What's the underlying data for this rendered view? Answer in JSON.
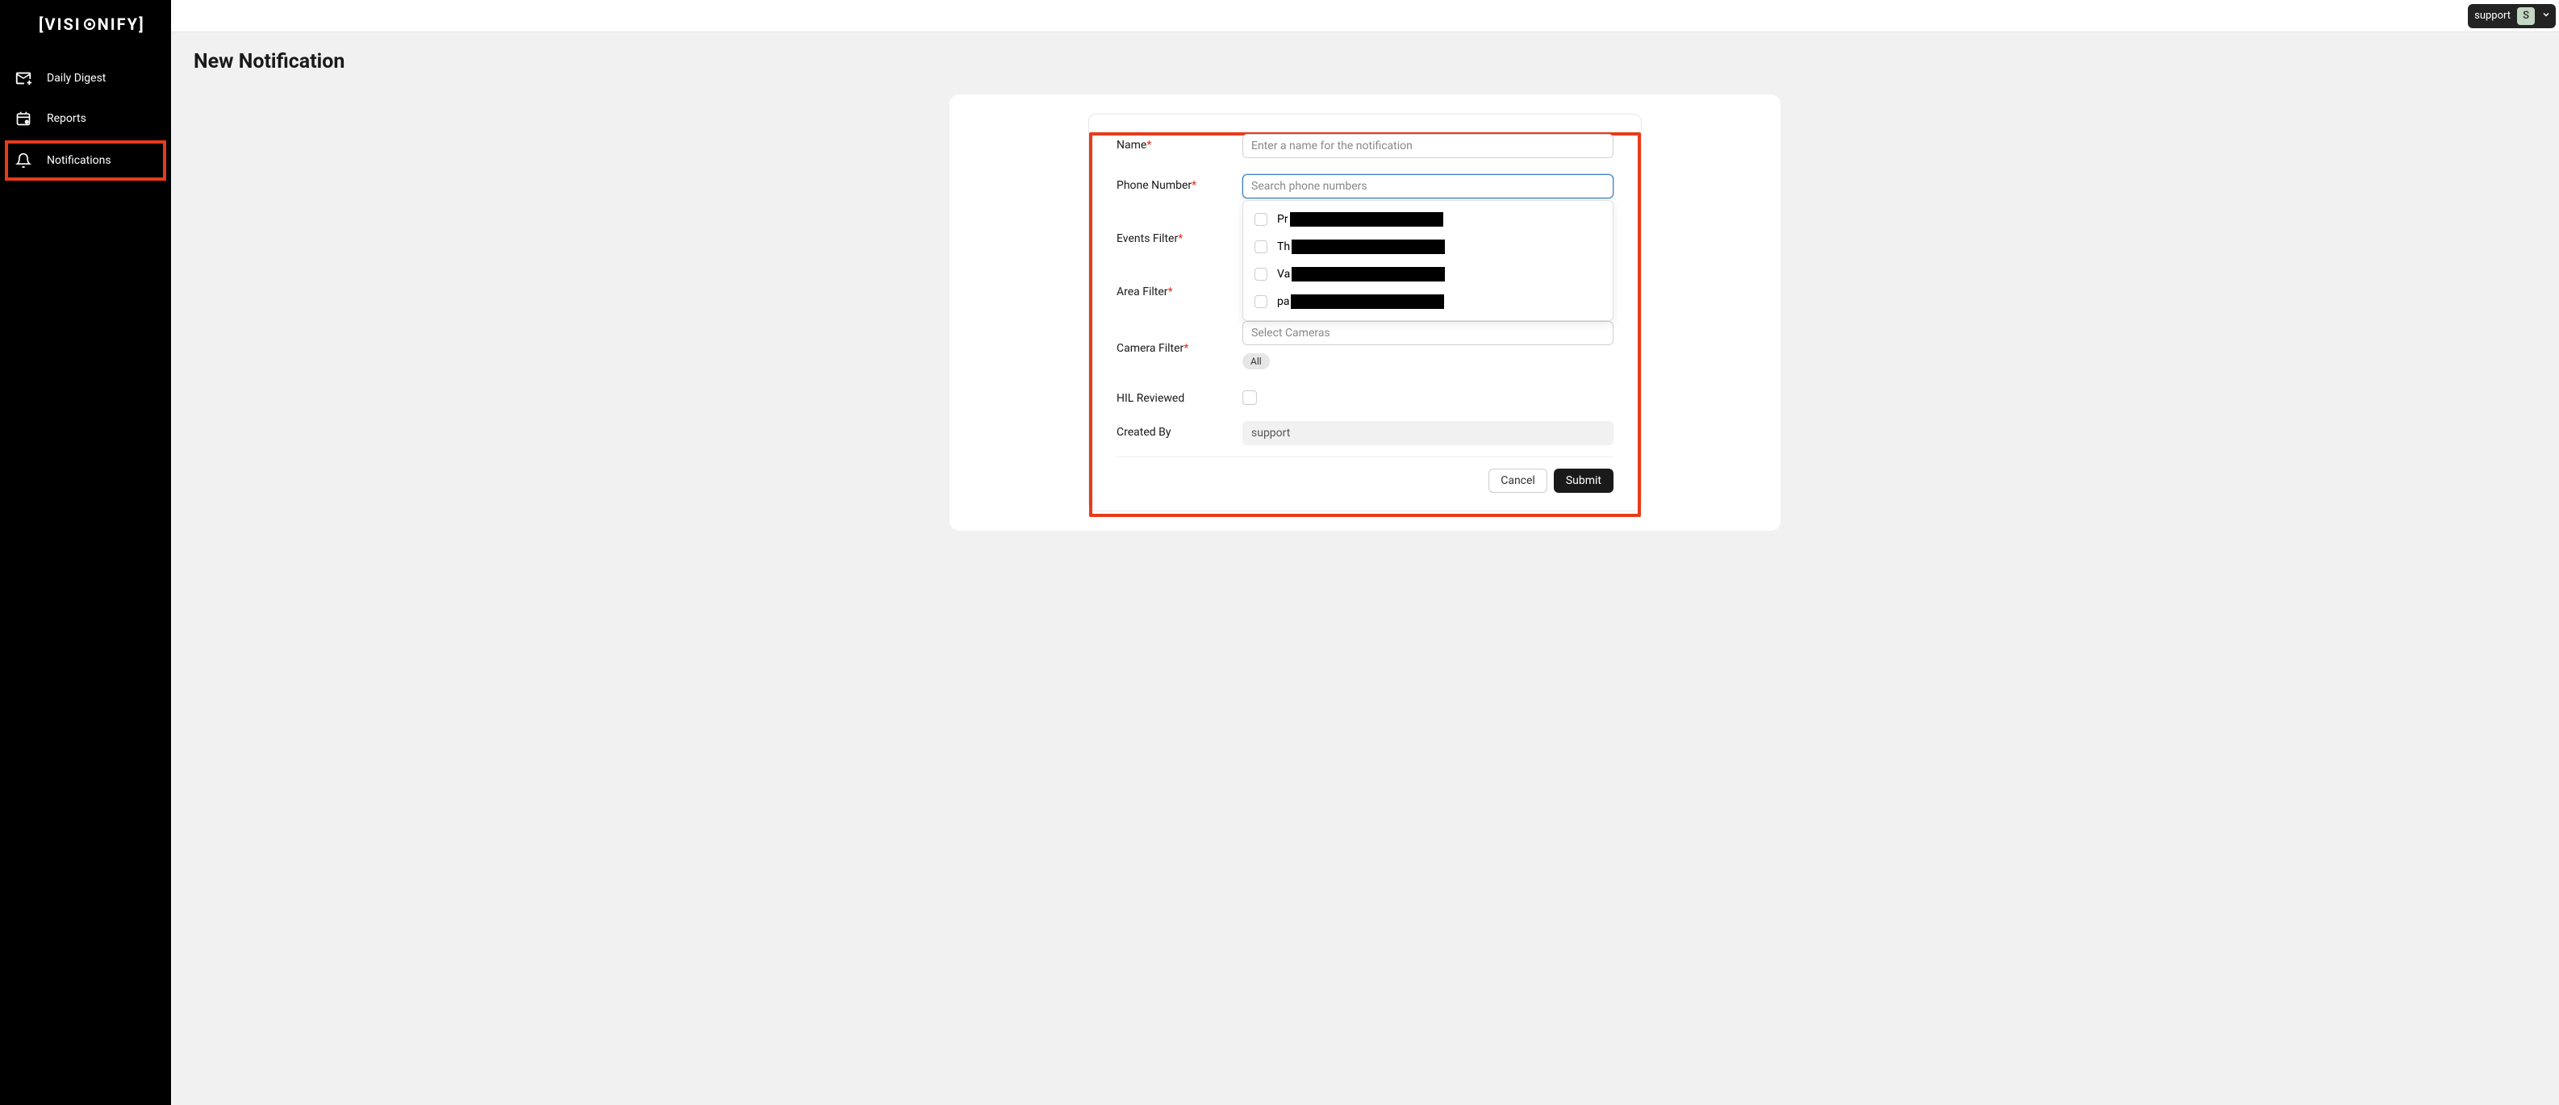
{
  "brand": {
    "logo_text": "[VISIONIFY]"
  },
  "sidebar": {
    "items": [
      {
        "label": "Daily Digest",
        "icon": "mail-plus-icon"
      },
      {
        "label": "Reports",
        "icon": "calendar-icon"
      },
      {
        "label": "Notifications",
        "icon": "bell-icon",
        "active": true
      }
    ]
  },
  "topbar": {
    "username": "support",
    "avatar_letter": "S"
  },
  "page": {
    "title": "New Notification"
  },
  "form": {
    "labels": {
      "name": "Name",
      "phone": "Phone Number",
      "events": "Events Filter",
      "area": "Area Filter",
      "camera": "Camera Filter",
      "hil": "HIL Reviewed",
      "created_by": "Created By"
    },
    "name_placeholder": "Enter a name for the notification",
    "name_value": "",
    "phone_placeholder": "Search phone numbers",
    "phone_value": "",
    "phone_options": [
      {
        "prefix": "Pr"
      },
      {
        "prefix": "Th"
      },
      {
        "prefix": "Va"
      },
      {
        "prefix": "pa"
      }
    ],
    "camera_placeholder": "Select Cameras",
    "camera_pill": "All",
    "created_by_value": "support",
    "buttons": {
      "cancel": "Cancel",
      "submit": "Submit"
    }
  }
}
